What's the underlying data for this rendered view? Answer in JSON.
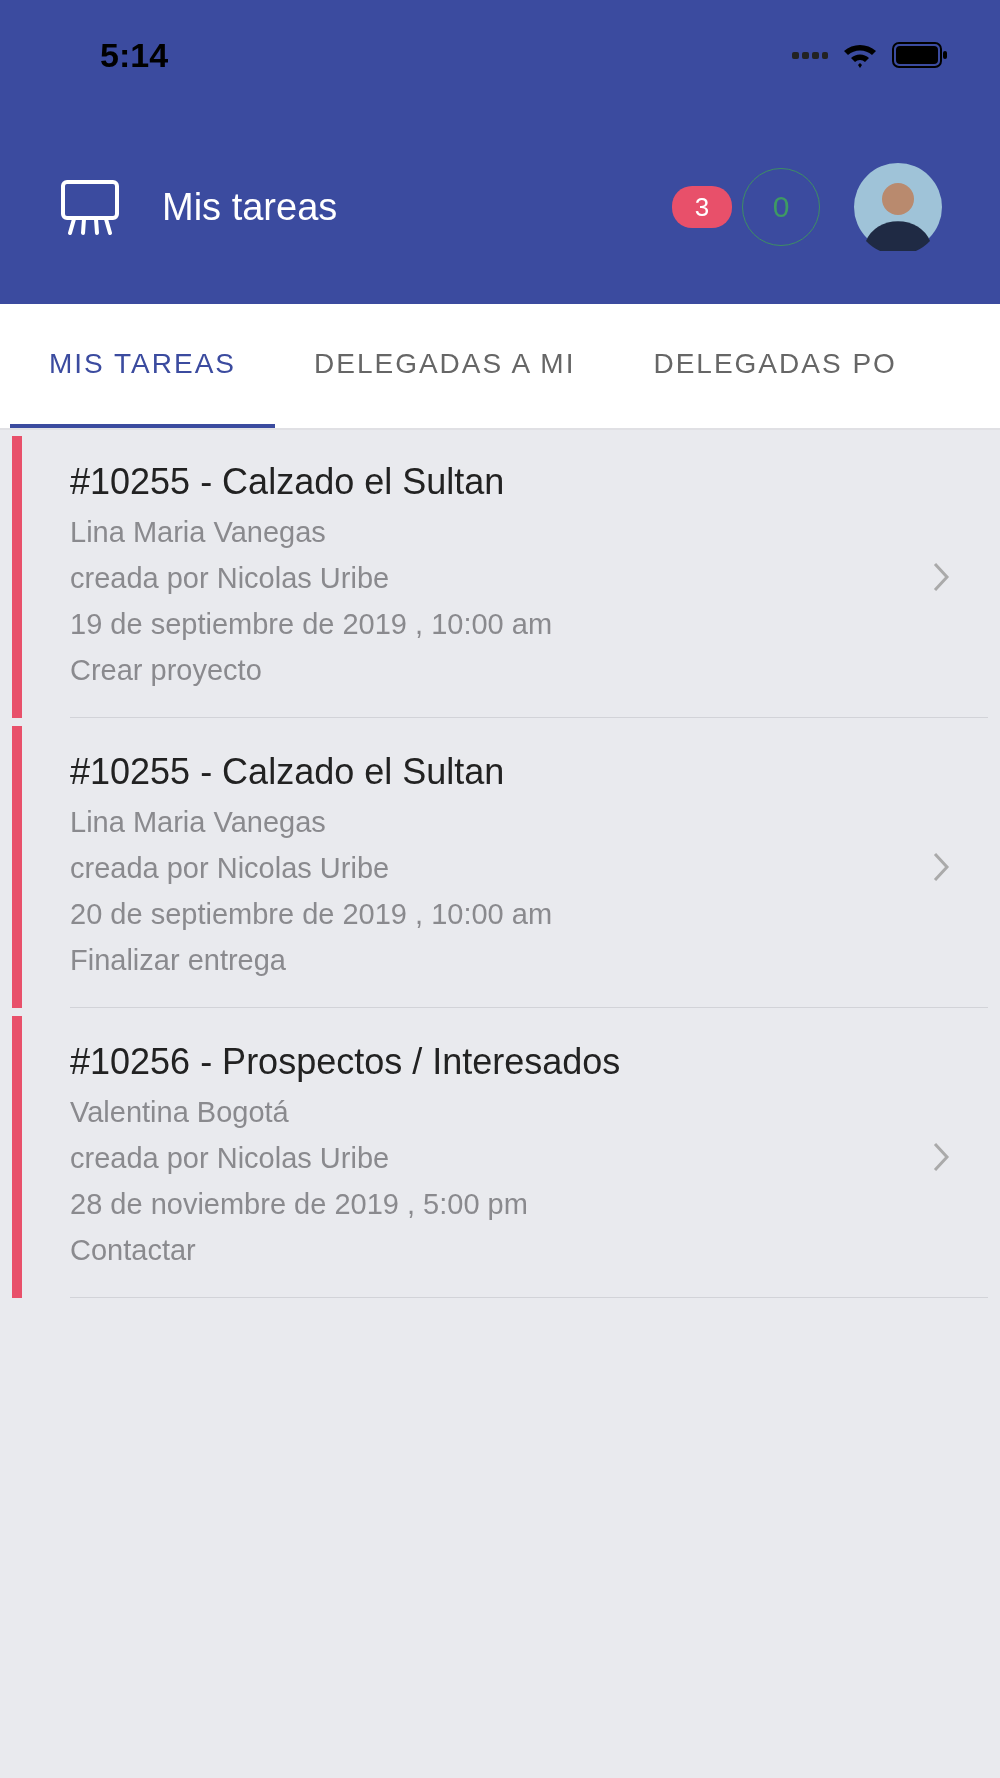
{
  "status_bar": {
    "time": "5:14"
  },
  "header": {
    "title": "Mis tareas",
    "badge": "3",
    "counter": "0"
  },
  "tabs": [
    {
      "label": "MIS TAREAS",
      "selected": true
    },
    {
      "label": "DELEGADAS A MI",
      "selected": false
    },
    {
      "label": "DELEGADAS PO",
      "selected": false
    }
  ],
  "tasks": [
    {
      "title": "#10255 - Calzado el Sultan",
      "client": "Lina Maria Vanegas",
      "creator": "creada por Nicolas Uribe",
      "date": "19 de septiembre de 2019 , 10:00 am",
      "action": "Crear proyecto"
    },
    {
      "title": "#10255 - Calzado el Sultan",
      "client": "Lina Maria Vanegas",
      "creator": "creada por Nicolas Uribe",
      "date": "20 de septiembre de 2019 , 10:00 am",
      "action": "Finalizar entrega"
    },
    {
      "title": "#10256 - Prospectos / Interesados",
      "client": "Valentina Bogotá",
      "creator": "creada por Nicolas Uribe",
      "date": "28 de noviembre de 2019 , 5:00 pm",
      "action": "Contactar"
    }
  ]
}
